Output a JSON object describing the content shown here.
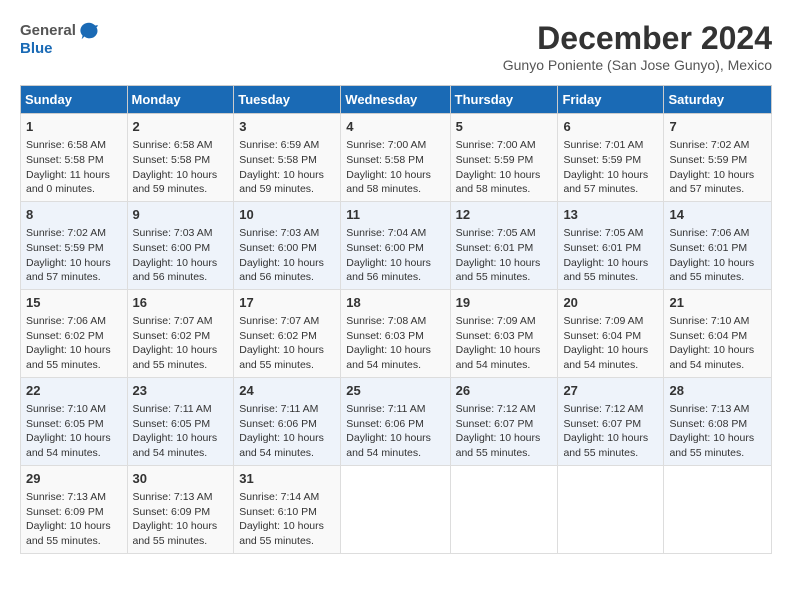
{
  "header": {
    "logo_general": "General",
    "logo_blue": "Blue",
    "month_title": "December 2024",
    "location": "Gunyo Poniente (San Jose Gunyo), Mexico"
  },
  "calendar": {
    "days_of_week": [
      "Sunday",
      "Monday",
      "Tuesday",
      "Wednesday",
      "Thursday",
      "Friday",
      "Saturday"
    ],
    "weeks": [
      [
        null,
        {
          "day": "2",
          "sunrise": "Sunrise: 6:58 AM",
          "sunset": "Sunset: 5:58 PM",
          "daylight": "Daylight: 10 hours and 59 minutes."
        },
        {
          "day": "3",
          "sunrise": "Sunrise: 6:59 AM",
          "sunset": "Sunset: 5:58 PM",
          "daylight": "Daylight: 10 hours and 59 minutes."
        },
        {
          "day": "4",
          "sunrise": "Sunrise: 7:00 AM",
          "sunset": "Sunset: 5:58 PM",
          "daylight": "Daylight: 10 hours and 58 minutes."
        },
        {
          "day": "5",
          "sunrise": "Sunrise: 7:00 AM",
          "sunset": "Sunset: 5:59 PM",
          "daylight": "Daylight: 10 hours and 58 minutes."
        },
        {
          "day": "6",
          "sunrise": "Sunrise: 7:01 AM",
          "sunset": "Sunset: 5:59 PM",
          "daylight": "Daylight: 10 hours and 57 minutes."
        },
        {
          "day": "7",
          "sunrise": "Sunrise: 7:02 AM",
          "sunset": "Sunset: 5:59 PM",
          "daylight": "Daylight: 10 hours and 57 minutes."
        }
      ],
      [
        {
          "day": "1",
          "sunrise": "Sunrise: 6:58 AM",
          "sunset": "Sunset: 5:58 PM",
          "daylight": "Daylight: 11 hours and 0 minutes."
        },
        null,
        null,
        null,
        null,
        null,
        null
      ],
      [
        {
          "day": "8",
          "sunrise": "Sunrise: 7:02 AM",
          "sunset": "Sunset: 5:59 PM",
          "daylight": "Daylight: 10 hours and 57 minutes."
        },
        {
          "day": "9",
          "sunrise": "Sunrise: 7:03 AM",
          "sunset": "Sunset: 6:00 PM",
          "daylight": "Daylight: 10 hours and 56 minutes."
        },
        {
          "day": "10",
          "sunrise": "Sunrise: 7:03 AM",
          "sunset": "Sunset: 6:00 PM",
          "daylight": "Daylight: 10 hours and 56 minutes."
        },
        {
          "day": "11",
          "sunrise": "Sunrise: 7:04 AM",
          "sunset": "Sunset: 6:00 PM",
          "daylight": "Daylight: 10 hours and 56 minutes."
        },
        {
          "day": "12",
          "sunrise": "Sunrise: 7:05 AM",
          "sunset": "Sunset: 6:01 PM",
          "daylight": "Daylight: 10 hours and 55 minutes."
        },
        {
          "day": "13",
          "sunrise": "Sunrise: 7:05 AM",
          "sunset": "Sunset: 6:01 PM",
          "daylight": "Daylight: 10 hours and 55 minutes."
        },
        {
          "day": "14",
          "sunrise": "Sunrise: 7:06 AM",
          "sunset": "Sunset: 6:01 PM",
          "daylight": "Daylight: 10 hours and 55 minutes."
        }
      ],
      [
        {
          "day": "15",
          "sunrise": "Sunrise: 7:06 AM",
          "sunset": "Sunset: 6:02 PM",
          "daylight": "Daylight: 10 hours and 55 minutes."
        },
        {
          "day": "16",
          "sunrise": "Sunrise: 7:07 AM",
          "sunset": "Sunset: 6:02 PM",
          "daylight": "Daylight: 10 hours and 55 minutes."
        },
        {
          "day": "17",
          "sunrise": "Sunrise: 7:07 AM",
          "sunset": "Sunset: 6:02 PM",
          "daylight": "Daylight: 10 hours and 55 minutes."
        },
        {
          "day": "18",
          "sunrise": "Sunrise: 7:08 AM",
          "sunset": "Sunset: 6:03 PM",
          "daylight": "Daylight: 10 hours and 54 minutes."
        },
        {
          "day": "19",
          "sunrise": "Sunrise: 7:09 AM",
          "sunset": "Sunset: 6:03 PM",
          "daylight": "Daylight: 10 hours and 54 minutes."
        },
        {
          "day": "20",
          "sunrise": "Sunrise: 7:09 AM",
          "sunset": "Sunset: 6:04 PM",
          "daylight": "Daylight: 10 hours and 54 minutes."
        },
        {
          "day": "21",
          "sunrise": "Sunrise: 7:10 AM",
          "sunset": "Sunset: 6:04 PM",
          "daylight": "Daylight: 10 hours and 54 minutes."
        }
      ],
      [
        {
          "day": "22",
          "sunrise": "Sunrise: 7:10 AM",
          "sunset": "Sunset: 6:05 PM",
          "daylight": "Daylight: 10 hours and 54 minutes."
        },
        {
          "day": "23",
          "sunrise": "Sunrise: 7:11 AM",
          "sunset": "Sunset: 6:05 PM",
          "daylight": "Daylight: 10 hours and 54 minutes."
        },
        {
          "day": "24",
          "sunrise": "Sunrise: 7:11 AM",
          "sunset": "Sunset: 6:06 PM",
          "daylight": "Daylight: 10 hours and 54 minutes."
        },
        {
          "day": "25",
          "sunrise": "Sunrise: 7:11 AM",
          "sunset": "Sunset: 6:06 PM",
          "daylight": "Daylight: 10 hours and 54 minutes."
        },
        {
          "day": "26",
          "sunrise": "Sunrise: 7:12 AM",
          "sunset": "Sunset: 6:07 PM",
          "daylight": "Daylight: 10 hours and 55 minutes."
        },
        {
          "day": "27",
          "sunrise": "Sunrise: 7:12 AM",
          "sunset": "Sunset: 6:07 PM",
          "daylight": "Daylight: 10 hours and 55 minutes."
        },
        {
          "day": "28",
          "sunrise": "Sunrise: 7:13 AM",
          "sunset": "Sunset: 6:08 PM",
          "daylight": "Daylight: 10 hours and 55 minutes."
        }
      ],
      [
        {
          "day": "29",
          "sunrise": "Sunrise: 7:13 AM",
          "sunset": "Sunset: 6:09 PM",
          "daylight": "Daylight: 10 hours and 55 minutes."
        },
        {
          "day": "30",
          "sunrise": "Sunrise: 7:13 AM",
          "sunset": "Sunset: 6:09 PM",
          "daylight": "Daylight: 10 hours and 55 minutes."
        },
        {
          "day": "31",
          "sunrise": "Sunrise: 7:14 AM",
          "sunset": "Sunset: 6:10 PM",
          "daylight": "Daylight: 10 hours and 55 minutes."
        },
        null,
        null,
        null,
        null
      ]
    ]
  }
}
